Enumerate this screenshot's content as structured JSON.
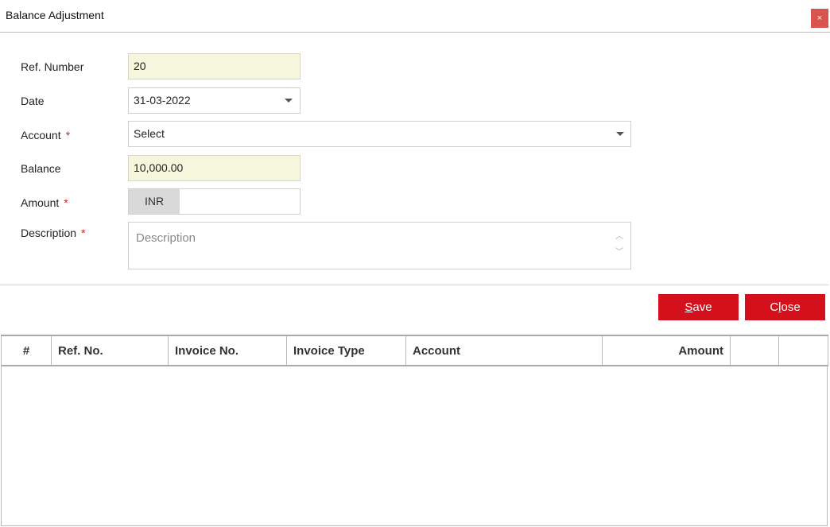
{
  "window": {
    "title": "Balance Adjustment",
    "close_glyph": "×"
  },
  "form": {
    "ref_number": {
      "label": "Ref. Number",
      "value": "20"
    },
    "date": {
      "label": "Date",
      "value": "31-03-2022"
    },
    "account": {
      "label": "Account",
      "required": "*",
      "value": "Select"
    },
    "balance": {
      "label": "Balance",
      "value": "10,000.00"
    },
    "amount": {
      "label": "Amount",
      "required": "*",
      "currency": "INR",
      "value": ""
    },
    "description": {
      "label": "Description",
      "required": "*",
      "placeholder": "Description"
    }
  },
  "buttons": {
    "save": {
      "mnemonic": "S",
      "rest": "ave"
    },
    "close": {
      "pre": "C",
      "mnemonic": "l",
      "rest": "ose"
    }
  },
  "colors": {
    "accent": "#d4101c",
    "readonly_bg": "#f6f6dd",
    "close_bg": "#d9534f"
  },
  "grid": {
    "columns": [
      "#",
      "Ref. No.",
      "Invoice No.",
      "Invoice Type",
      "Account",
      "Amount",
      "",
      ""
    ],
    "rows": []
  }
}
